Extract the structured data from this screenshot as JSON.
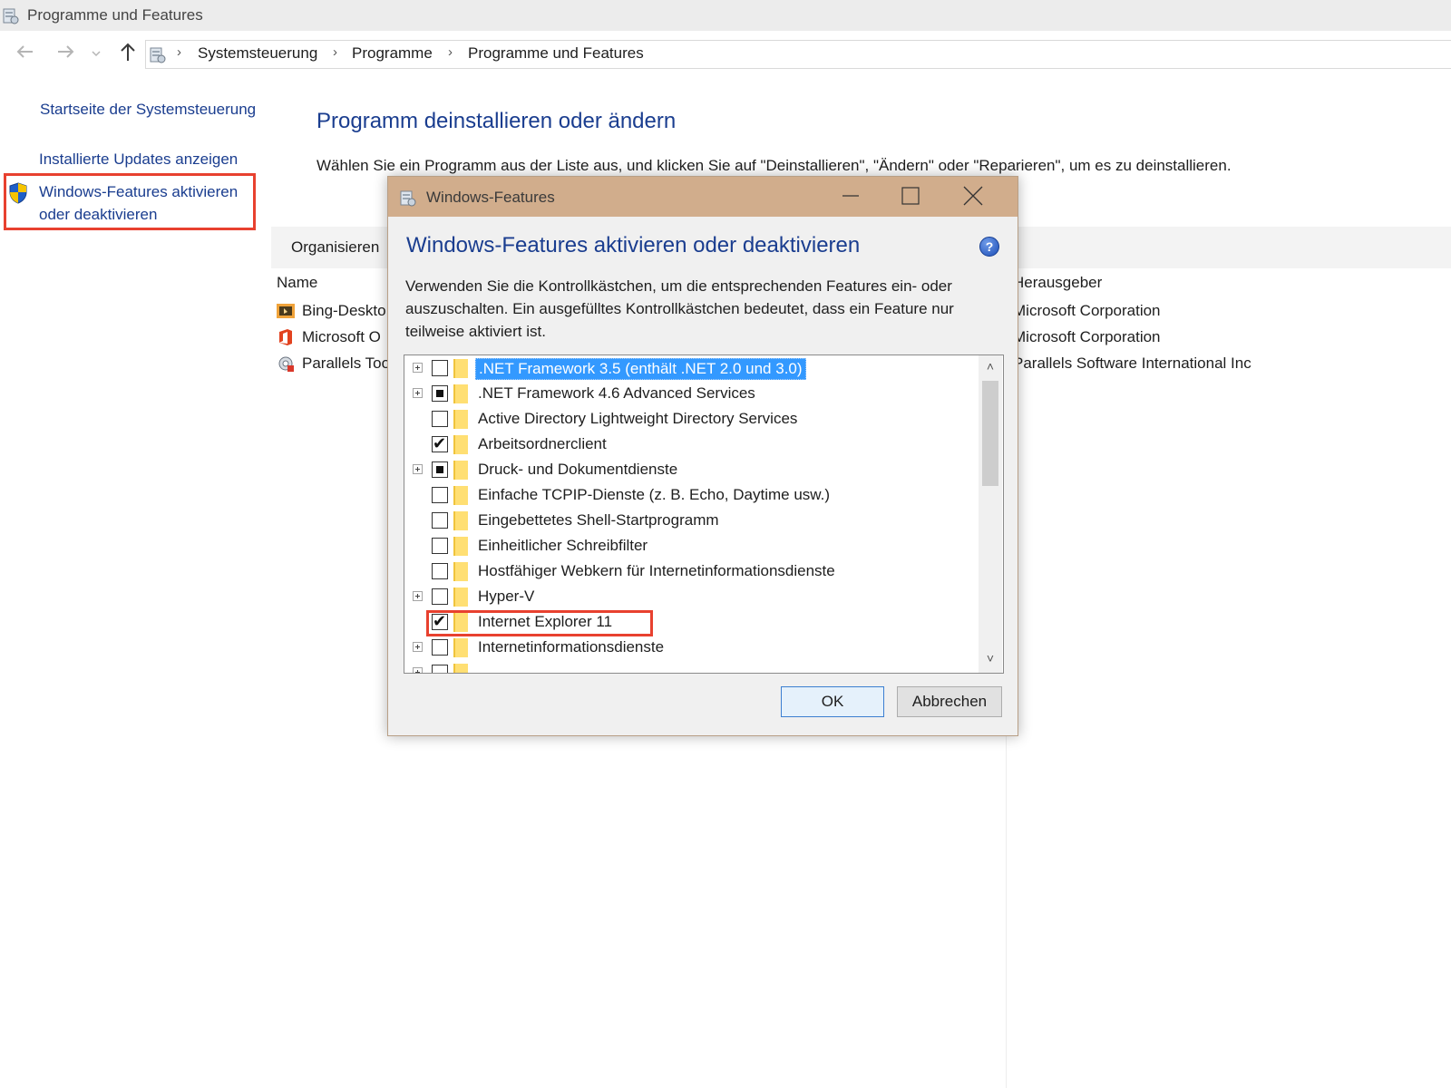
{
  "window": {
    "title": "Programme und Features"
  },
  "breadcrumb": [
    "Systemsteuerung",
    "Programme",
    "Programme und Features"
  ],
  "nav": {
    "back_icon": "arrow-left-icon",
    "forward_icon": "arrow-right-icon",
    "recent_icon": "chevron-down-icon",
    "up_icon": "arrow-up-icon"
  },
  "sidebar": {
    "links": [
      "Startseite der Systemsteuerung",
      "Installierte Updates anzeigen",
      "Windows-Features aktivieren",
      "oder deaktivieren"
    ]
  },
  "main": {
    "title": "Programm deinstallieren oder ändern",
    "description": "Wählen Sie ein Programm aus der Liste aus, und klicken Sie auf \"Deinstallieren\", \"Ändern\" oder \"Reparieren\", um es zu deinstallieren.",
    "toolbar_organize": "Organisieren",
    "columns": [
      "Name",
      "Herausgeber"
    ],
    "programs": [
      {
        "name": "Bing-Deskto",
        "publisher": "Microsoft Corporation"
      },
      {
        "name": "Microsoft O",
        "publisher": "Microsoft Corporation"
      },
      {
        "name": "Parallels Too",
        "publisher": "Parallels Software International Inc"
      }
    ]
  },
  "dialog": {
    "title": "Windows-Features",
    "heading": "Windows-Features aktivieren oder deaktivieren",
    "help": "?",
    "description": "Verwenden Sie die Kontrollkästchen, um die entsprechenden Features ein- oder auszuschalten. Ein ausgefülltes Kontrollkästchen bedeutet, dass ein Feature nur teilweise aktiviert ist.",
    "features": [
      {
        "label": ".NET Framework 3.5 (enthält .NET 2.0 und 3.0)",
        "expandable": true,
        "state": "unchecked",
        "selected": true
      },
      {
        "label": ".NET Framework 4.6 Advanced Services",
        "expandable": true,
        "state": "partial"
      },
      {
        "label": "Active Directory Lightweight Directory Services",
        "expandable": false,
        "state": "unchecked"
      },
      {
        "label": "Arbeitsordnerclient",
        "expandable": false,
        "state": "checked"
      },
      {
        "label": "Druck- und Dokumentdienste",
        "expandable": true,
        "state": "partial"
      },
      {
        "label": "Einfache TCPIP-Dienste (z. B. Echo, Daytime usw.)",
        "expandable": false,
        "state": "unchecked"
      },
      {
        "label": "Eingebettetes Shell-Startprogramm",
        "expandable": false,
        "state": "unchecked"
      },
      {
        "label": "Einheitlicher Schreibfilter",
        "expandable": false,
        "state": "unchecked"
      },
      {
        "label": "Hostfähiger Webkern für Internetinformationsdienste",
        "expandable": false,
        "state": "unchecked"
      },
      {
        "label": "Hyper-V",
        "expandable": true,
        "state": "unchecked"
      },
      {
        "label": "Internet Explorer 11",
        "expandable": false,
        "state": "checked"
      },
      {
        "label": "Internetinformationsdienste",
        "expandable": true,
        "state": "unchecked"
      },
      {
        "label": "",
        "expandable": true,
        "state": "unchecked"
      }
    ],
    "ok_label": "OK",
    "cancel_label": "Abbrechen"
  },
  "colors": {
    "link": "#1a3d8f",
    "highlight_box": "#e8412f",
    "dialog_titlebar": "#d1ad8c",
    "selection": "#3399ff"
  }
}
